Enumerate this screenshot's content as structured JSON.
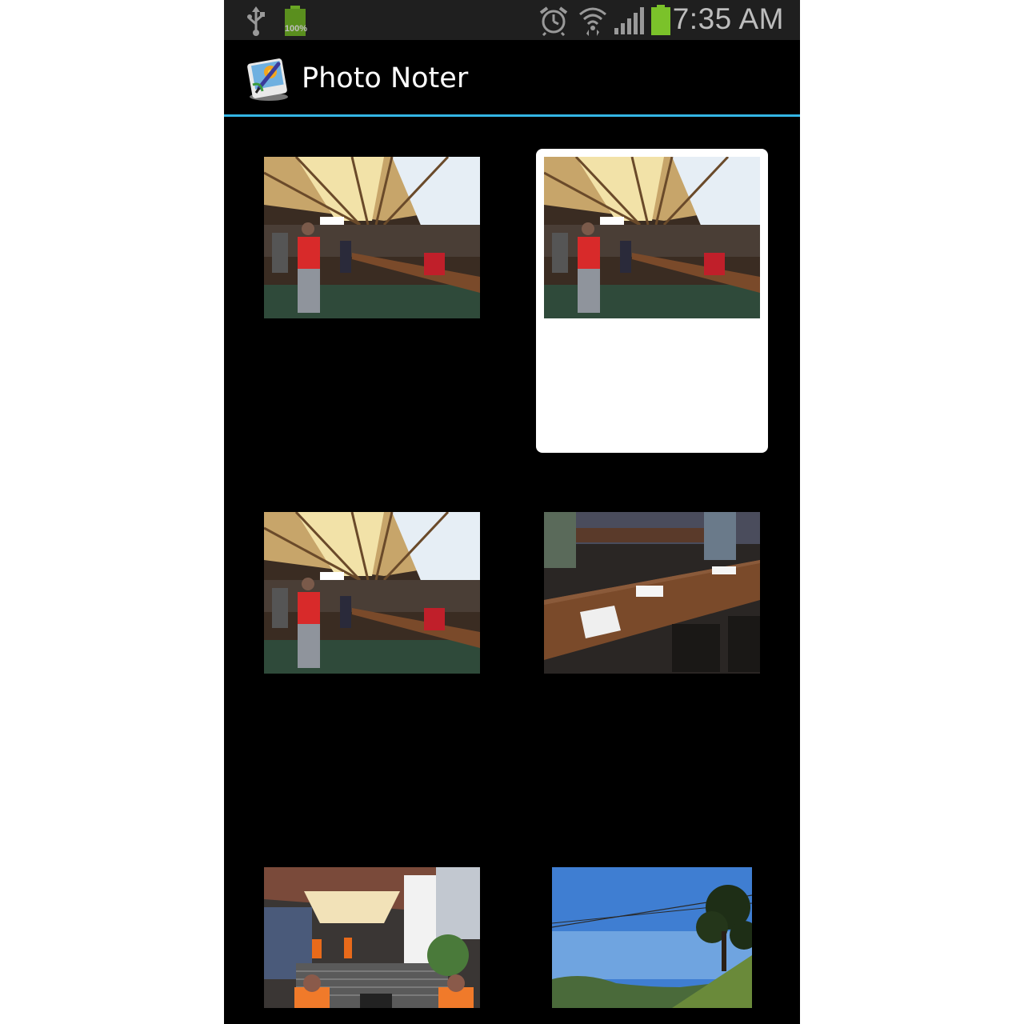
{
  "status_bar": {
    "time": "7:35 AM",
    "battery_left_label": "100%",
    "icons": [
      "usb-icon",
      "battery-icon",
      "alarm-icon",
      "wifi-icon",
      "signal-icon",
      "battery-icon"
    ],
    "battery_color": "#7bc22a"
  },
  "action_bar": {
    "title": "Photo Noter",
    "app_icon": "photo-noter-app-icon",
    "accent_color": "#33b5e5"
  },
  "grid": {
    "items": [
      {
        "name": "hall-photo-1",
        "selected": false
      },
      {
        "name": "hall-photo-2",
        "selected": true
      },
      {
        "name": "hall-photo-3",
        "selected": false
      },
      {
        "name": "table-photo",
        "selected": false
      },
      {
        "name": "stairs-photo",
        "selected": false
      },
      {
        "name": "sky-photo",
        "selected": false
      }
    ]
  }
}
